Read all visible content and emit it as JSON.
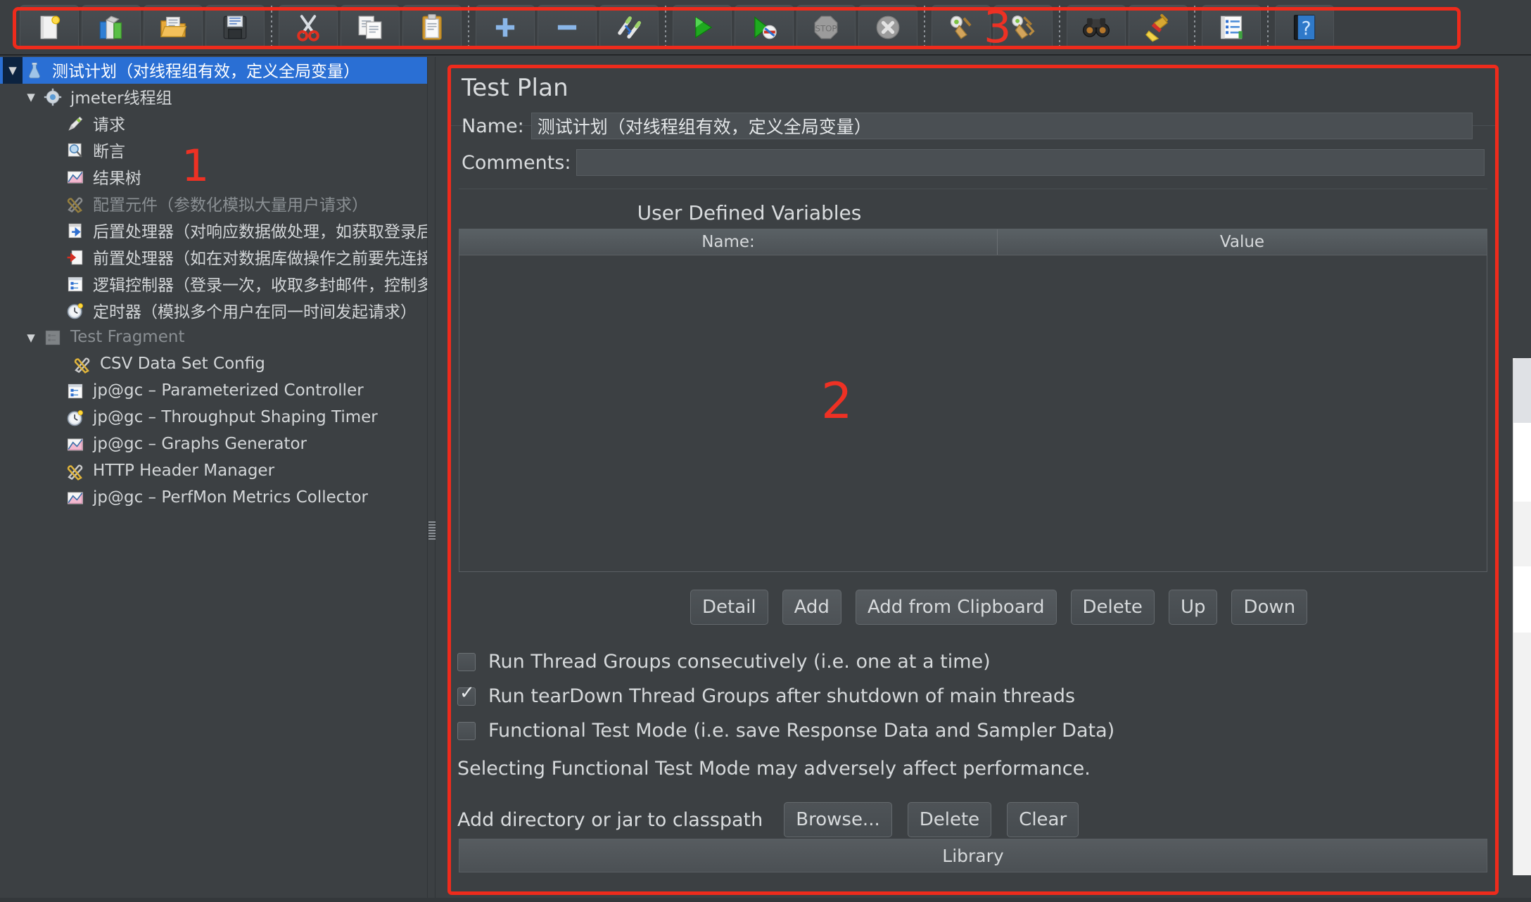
{
  "toolbar": {
    "groups": [
      {
        "buttons": [
          {
            "name": "new-test-plan-button",
            "icon": "new-document-icon",
            "label": "New"
          },
          {
            "name": "templates-button",
            "icon": "templates-books-icon",
            "label": "Templates"
          },
          {
            "name": "open-button",
            "icon": "open-folder-icon",
            "label": "Open"
          },
          {
            "name": "save-button",
            "icon": "floppy-disk-icon",
            "label": "Save Test Plan"
          }
        ]
      },
      {
        "buttons": [
          {
            "name": "cut-button",
            "icon": "scissors-icon",
            "label": "Cut"
          },
          {
            "name": "copy-button",
            "icon": "copy-pages-icon",
            "label": "Copy"
          },
          {
            "name": "paste-button",
            "icon": "clipboard-icon",
            "label": "Paste"
          }
        ]
      },
      {
        "buttons": [
          {
            "name": "expand-all-button",
            "icon": "plus-icon",
            "label": "Expand All"
          },
          {
            "name": "collapse-all-button",
            "icon": "minus-icon",
            "label": "Collapse All"
          },
          {
            "name": "toggle-button",
            "icon": "toggle-pencils-icon",
            "label": "Toggle"
          }
        ]
      },
      {
        "buttons": [
          {
            "name": "start-button",
            "icon": "green-play-icon",
            "label": "Start"
          },
          {
            "name": "start-no-timers-button",
            "icon": "play-no-timers-icon",
            "label": "Start no pauses"
          },
          {
            "name": "stop-button",
            "icon": "stop-sign-icon",
            "label": "Stop"
          },
          {
            "name": "shutdown-button",
            "icon": "shutdown-x-icon",
            "label": "Shutdown"
          }
        ]
      },
      {
        "buttons": [
          {
            "name": "clear-button",
            "icon": "gear-broom-icon",
            "label": "Clear"
          },
          {
            "name": "clear-all-button",
            "icon": "gear-broom-double-icon",
            "label": "Clear All"
          }
        ]
      },
      {
        "buttons": [
          {
            "name": "search-button",
            "icon": "binoculars-icon",
            "label": "Search"
          },
          {
            "name": "reset-search-button",
            "icon": "yellow-broom-icon",
            "label": "Reset Search"
          }
        ]
      },
      {
        "buttons": [
          {
            "name": "function-helper-button",
            "icon": "function-helper-list-icon",
            "label": "Function Helper Dialog"
          }
        ]
      },
      {
        "buttons": [
          {
            "name": "help-button",
            "icon": "help-question-icon",
            "label": "Help"
          }
        ]
      }
    ]
  },
  "annotations": {
    "one": "1",
    "two": "2",
    "three": "3"
  },
  "tree": {
    "items": [
      {
        "label": "测试计划（对线程组有效，定义全局变量）",
        "icon": "test-plan-flask-icon",
        "indent": 0,
        "twisty": "▼",
        "selected": true,
        "dim": false
      },
      {
        "label": "jmeter线程组",
        "icon": "thread-group-gear-icon",
        "indent": 1,
        "twisty": "▼",
        "selected": false,
        "dim": false
      },
      {
        "label": "请求",
        "icon": "sampler-pen-icon",
        "indent": 2,
        "twisty": "",
        "selected": false,
        "dim": false
      },
      {
        "label": "断言",
        "icon": "assertion-magnifier-icon",
        "indent": 2,
        "twisty": "",
        "selected": false,
        "dim": false
      },
      {
        "label": "结果树",
        "icon": "results-tree-chart-icon",
        "indent": 2,
        "twisty": "",
        "selected": false,
        "dim": false
      },
      {
        "label": "配置元件（参数化模拟大量用户请求）",
        "icon": "config-element-tools-icon",
        "indent": 2,
        "twisty": "",
        "selected": false,
        "dim": true
      },
      {
        "label": "后置处理器（对响应数据做处理，如获取登录后的token）",
        "icon": "post-processor-icon",
        "indent": 2,
        "twisty": "",
        "selected": false,
        "dim": false
      },
      {
        "label": "前置处理器（如在对数据库做操作之前要先连接数据库）",
        "icon": "pre-processor-icon",
        "indent": 2,
        "twisty": "",
        "selected": false,
        "dim": false
      },
      {
        "label": "逻辑控制器（登录一次，收取多封邮件，控制多个请求）",
        "icon": "logic-controller-icon",
        "indent": 2,
        "twisty": "",
        "selected": false,
        "dim": false
      },
      {
        "label": "定时器（模拟多个用户在同一时间发起请求）",
        "icon": "timer-clock-icon",
        "indent": 2,
        "twisty": "",
        "selected": false,
        "dim": false
      },
      {
        "label": "Test Fragment",
        "icon": "test-fragment-icon",
        "indent": 1,
        "twisty": "▼",
        "selected": false,
        "dim": true
      },
      {
        "label": "CSV Data Set Config",
        "icon": "config-element-tools-icon",
        "indent": 3,
        "twisty": "",
        "selected": false,
        "dim": false
      },
      {
        "label": "jp@gc – Parameterized Controller",
        "icon": "logic-controller-icon",
        "indent": 2,
        "twisty": "",
        "selected": false,
        "dim": false
      },
      {
        "label": "jp@gc – Throughput Shaping Timer",
        "icon": "timer-clock-icon",
        "indent": 2,
        "twisty": "",
        "selected": false,
        "dim": false
      },
      {
        "label": "jp@gc – Graphs Generator",
        "icon": "results-tree-chart-icon",
        "indent": 2,
        "twisty": "",
        "selected": false,
        "dim": false
      },
      {
        "label": "HTTP Header Manager",
        "icon": "config-element-tools-icon",
        "indent": 2,
        "twisty": "",
        "selected": false,
        "dim": false
      },
      {
        "label": "jp@gc – PerfMon Metrics Collector",
        "icon": "results-tree-chart-icon",
        "indent": 2,
        "twisty": "",
        "selected": false,
        "dim": false
      }
    ]
  },
  "panel": {
    "title": "Test Plan",
    "name_label": "Name:",
    "name_value": "测试计划（对线程组有效，定义全局变量）",
    "comments_label": "Comments:",
    "comments_value": "",
    "udv_title": "User Defined Variables",
    "table": {
      "columns": [
        "Name:",
        "Value"
      ],
      "rows": []
    },
    "table_buttons": [
      {
        "name": "detail-button",
        "label": "Detail"
      },
      {
        "name": "add-button",
        "label": "Add"
      },
      {
        "name": "add-from-clipboard-button",
        "label": "Add from Clipboard"
      },
      {
        "name": "delete-variable-button",
        "label": "Delete"
      },
      {
        "name": "up-button",
        "label": "Up"
      },
      {
        "name": "down-button",
        "label": "Down"
      }
    ],
    "checkboxes": [
      {
        "name": "run-thread-groups-consecutively-checkbox",
        "label": "Run Thread Groups consecutively (i.e. one at a time)",
        "checked": false
      },
      {
        "name": "run-teardown-thread-groups-checkbox",
        "label": "Run tearDown Thread Groups after shutdown of main threads",
        "checked": true
      },
      {
        "name": "functional-test-mode-checkbox",
        "label": "Functional Test Mode (i.e. save Response Data and Sampler Data)",
        "checked": false
      }
    ],
    "functional_note": "Selecting Functional Test Mode may adversely affect performance.",
    "classpath_label": "Add directory or jar to classpath",
    "classpath_buttons": [
      {
        "name": "browse-button",
        "label": "Browse..."
      },
      {
        "name": "delete-classpath-button",
        "label": "Delete"
      },
      {
        "name": "clear-classpath-button",
        "label": "Clear"
      }
    ],
    "library_header": "Library"
  },
  "colors": {
    "accent_red": "#ee2b1c",
    "selection_blue": "#2a6fd4",
    "panel_bg": "#3c4043",
    "text": "#d6d9db"
  }
}
